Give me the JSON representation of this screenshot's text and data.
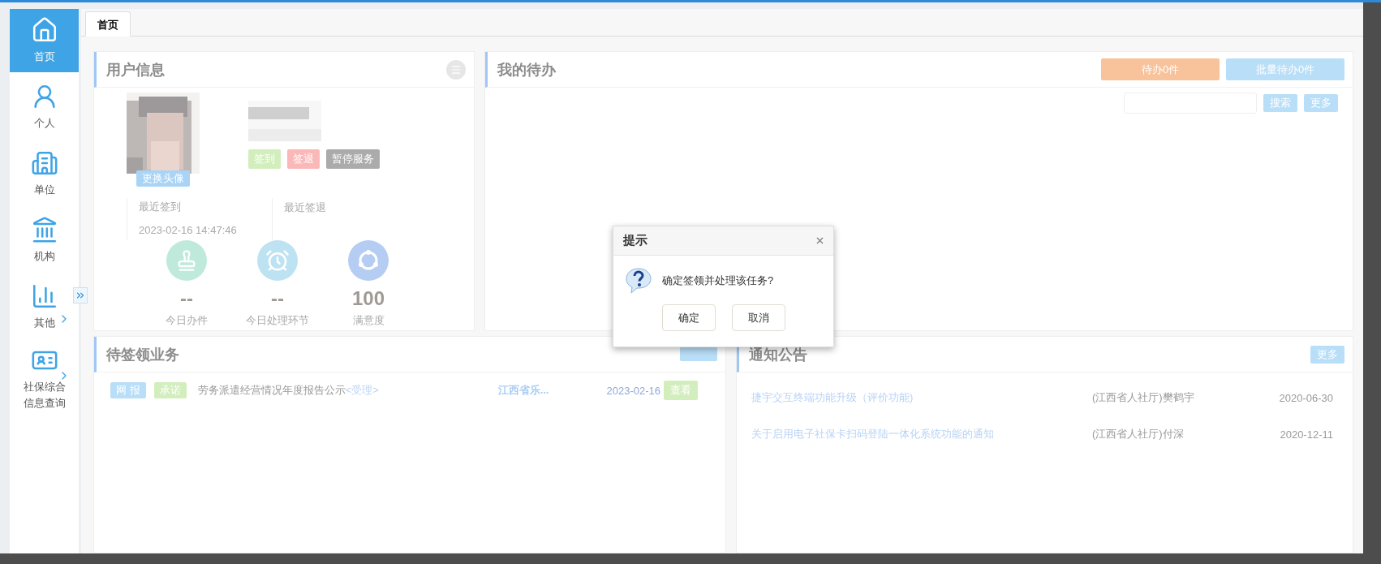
{
  "sidebar": {
    "items": [
      {
        "label": "首页",
        "selected": true,
        "expandable": false
      },
      {
        "label": "个人",
        "selected": false,
        "expandable": false
      },
      {
        "label": "单位",
        "selected": false,
        "expandable": false
      },
      {
        "label": "机构",
        "selected": false,
        "expandable": false
      },
      {
        "label": "其他",
        "selected": false,
        "expandable": true
      },
      {
        "label": "社保综合信息查询",
        "selected": false,
        "expandable": true
      }
    ]
  },
  "tabs": [
    {
      "label": "首页",
      "selected": true
    }
  ],
  "user_info": {
    "title": "用户信息",
    "avatar": {
      "kind": "picture",
      "button": "更换头像"
    },
    "actions": [
      {
        "label": "签到",
        "color": "#d3eebd"
      },
      {
        "label": "签退",
        "color": "#fbb8b8"
      },
      {
        "label": "暂停服务",
        "color": "#ababab"
      }
    ],
    "last_sign_in": {
      "label": "最近签到",
      "value": "2023-02-16 14:47:46"
    },
    "last_sign_out": {
      "label": "最近签退"
    },
    "stats": [
      {
        "value": "--",
        "label": "今日办件",
        "color": "#bfeadb"
      },
      {
        "value": "--",
        "label": "今日处理环节",
        "color": "#bde2f2"
      },
      {
        "value": "100",
        "label": "满意度",
        "color": "#b5cdf3"
      }
    ]
  },
  "todo": {
    "title": "我的待办",
    "badges": [
      {
        "label": "待办0件",
        "color": "#f8c29a"
      },
      {
        "label": "批量待办0件",
        "color": "#b9def8"
      }
    ],
    "search": {
      "button": "搜索"
    },
    "more": "更多"
  },
  "pending": {
    "title": "待签领业务",
    "rows": [
      {
        "tags": [
          {
            "label": "网 报",
            "color": "#b9def8"
          },
          {
            "label": "承诺",
            "color": "#d3eebd"
          }
        ],
        "title": "劳务派遣经营情况年度报告公示",
        "link": "<受理>",
        "org": "江西省乐...",
        "date": "2023-02-16",
        "action": "查看"
      }
    ]
  },
  "notices": {
    "title": "通知公告",
    "more": "更多",
    "rows": [
      {
        "title": "捷宇交互终端功能升级（评价功能)",
        "publisher": "(江西省人社厅)樊鹤宇",
        "date": "2020-06-30"
      },
      {
        "title": "关于启用电子社保卡扫码登陆一体化系统功能的通知",
        "publisher": "(江西省人社厅)付深",
        "date": "2020-12-11"
      }
    ]
  },
  "dialog": {
    "title": "提示",
    "message": "确定签领并处理该任务?",
    "buttons": [
      {
        "label": "确定"
      },
      {
        "label": "取消"
      }
    ]
  }
}
